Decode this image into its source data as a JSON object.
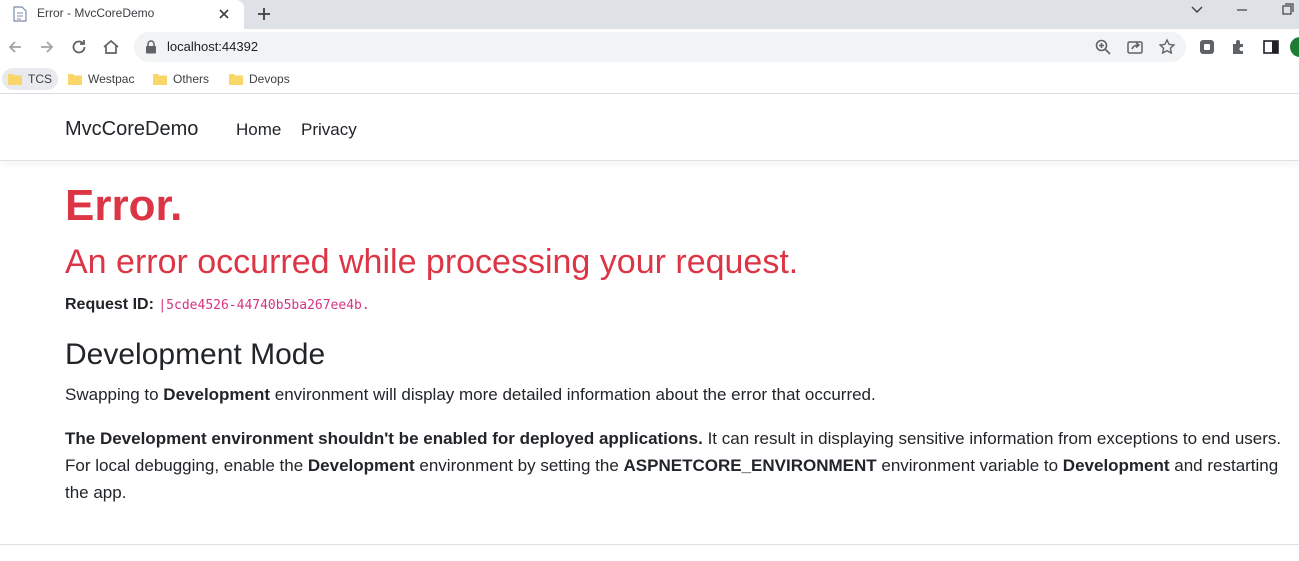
{
  "browser": {
    "tab_title": "Error - MvcCoreDemo",
    "url": "localhost:44392",
    "bookmarks": [
      "TCS",
      "Westpac",
      "Others",
      "Devops"
    ]
  },
  "navbar": {
    "brand": "MvcCoreDemo",
    "links": [
      "Home",
      "Privacy"
    ]
  },
  "page": {
    "error_title": "Error.",
    "error_subtitle": "An error occurred while processing your request.",
    "request_id_label": "Request ID:",
    "request_id_value": "|5cde4526-44740b5ba267ee4b.",
    "dev_heading": "Development Mode",
    "p1": {
      "a": "Swapping to ",
      "b": "Development",
      "c": " environment will display more detailed information about the error that occurred."
    },
    "p2": {
      "a": "The Development environment shouldn't be enabled for deployed applications.",
      "b": " It can result in displaying sensitive information from exceptions to end users. For local debugging, enable the ",
      "c": "Development",
      "d": " environment by setting the ",
      "e": "ASPNETCORE_ENVIRONMENT",
      "f": " environment variable to ",
      "g": "Development",
      "h": " and restarting the app."
    }
  },
  "colors": {
    "error_red": "#dc3545",
    "code_pink": "#d63384",
    "folder_yellow": "#f9d66a"
  }
}
